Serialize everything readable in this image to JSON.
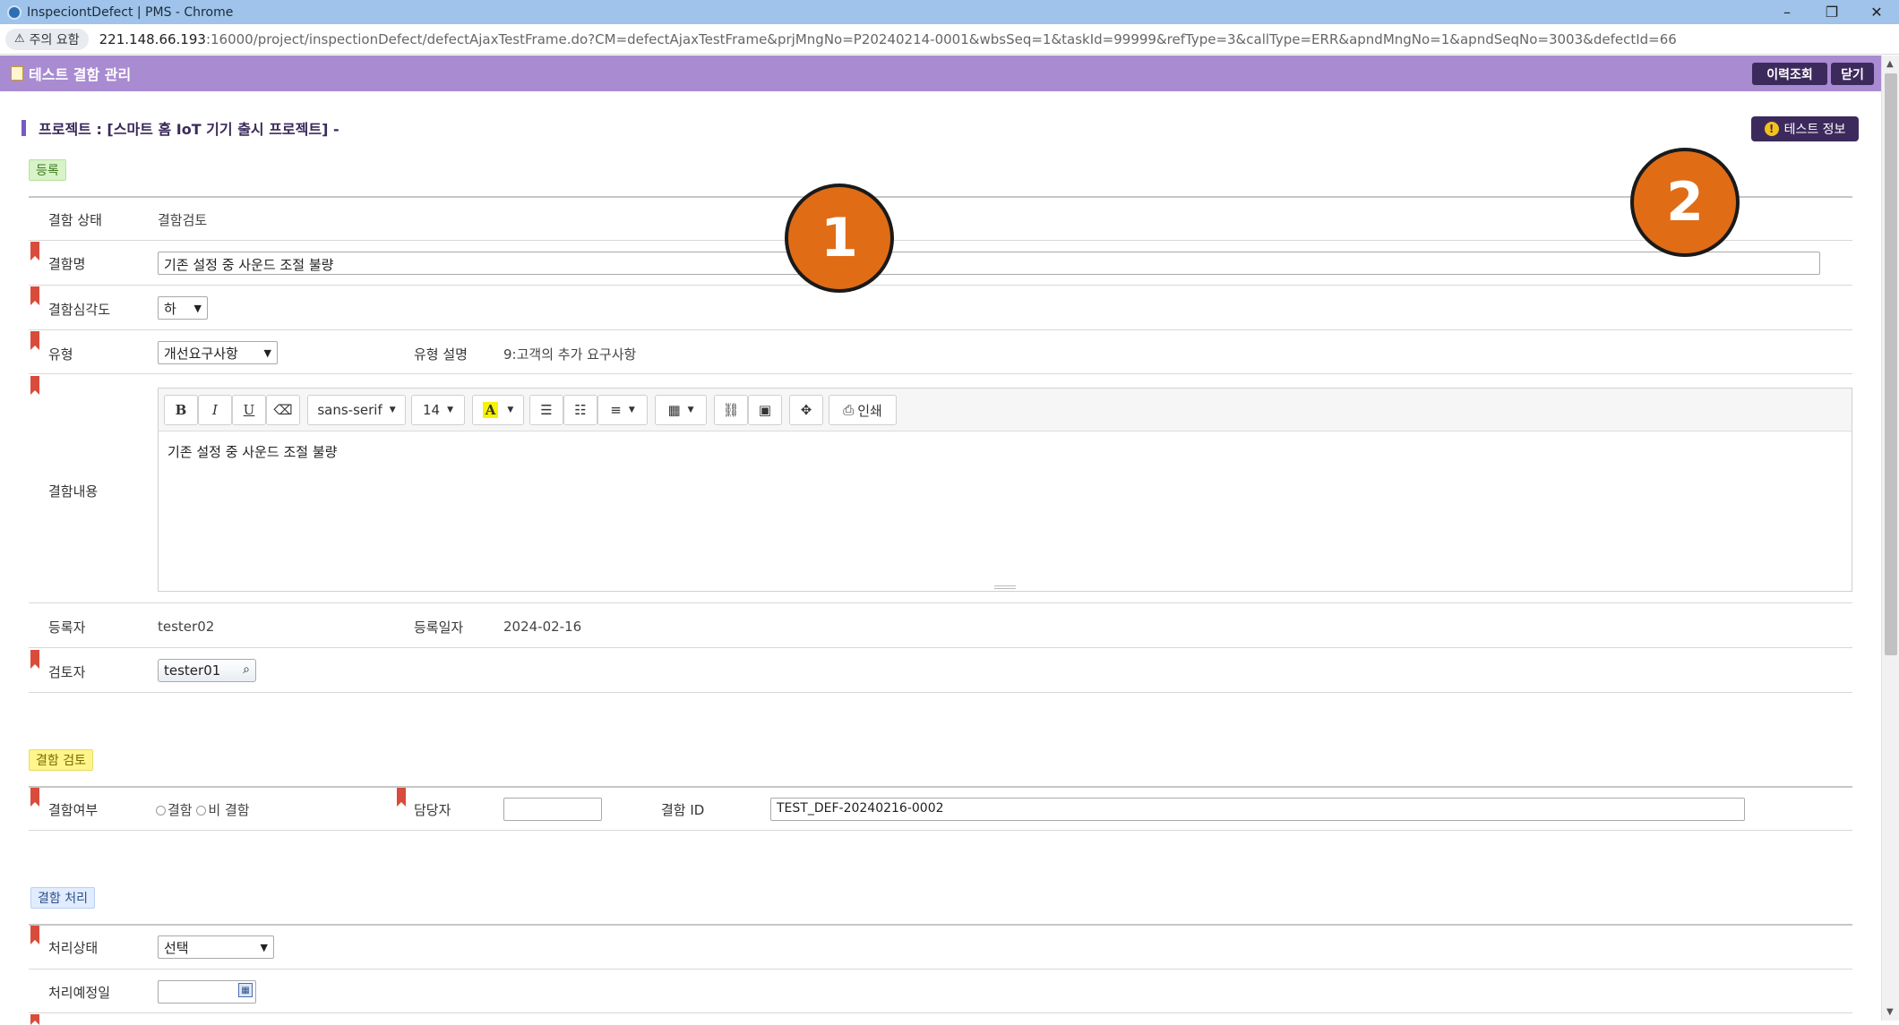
{
  "window": {
    "title": "InspeciontDefect | PMS - Chrome",
    "controls": {
      "minimize": "–",
      "restore": "❐",
      "close": "✕"
    }
  },
  "addressbar": {
    "security_label": "주의 요함",
    "url_host": "221.148.66.193",
    "url_rest": ":16000/project/inspectionDefect/defectAjaxTestFrame.do?CM=defectAjaxTestFrame&prjMngNo=P20240214-0001&wbsSeq=1&taskId=99999&refType=3&callType=ERR&apndMngNo=1&apndSeqNo=3003&defectId=66"
  },
  "header": {
    "title": "테스트 결함 관리",
    "history_button": "이력조회",
    "close_button": "닫기"
  },
  "project": {
    "line": "프로젝트 : [스마트 홈 IoT 기기 출시 프로젝트] -",
    "test_info_button": "테스트 정보"
  },
  "sections": {
    "register": "등록",
    "review": "결함 검토",
    "process": "결함 처리"
  },
  "form": {
    "status_label": "결함 상태",
    "status_value": "결함검토",
    "name_label": "결함명",
    "name_value": "기존 설정 중 사운드 조절 불량",
    "severity_label": "결함심각도",
    "severity_value": "하",
    "type_label": "유형",
    "type_value": "개선요구사항",
    "type_desc_label": "유형 설명",
    "type_desc_value": "9:고객의 추가 요구사항",
    "content_label": "결함내용",
    "content_value": "기존 설정 중 사운드 조절 불량",
    "registrant_label": "등록자",
    "registrant_value": "tester02",
    "reg_date_label": "등록일자",
    "reg_date_value": "2024-02-16",
    "reviewer_label": "검토자",
    "reviewer_value": "tester01",
    "defect_yn_label": "결함여부",
    "defect_yes": "결함",
    "defect_no": "비 결함",
    "assignee_label": "담당자",
    "assignee_value": "",
    "defect_id_label": "결함 ID",
    "defect_id_value": "TEST_DEF-20240216-0002",
    "proc_status_label": "처리상태",
    "proc_status_value": "선택",
    "proc_date_label": "처리예정일",
    "proc_date_value": ""
  },
  "editor": {
    "bold": "B",
    "italic": "I",
    "underline": "U",
    "eraser": "⌫",
    "font_family": "sans-serif",
    "font_size": "14",
    "color": "A",
    "print": "인쇄"
  },
  "annotations": [
    "1",
    "2"
  ],
  "colors": {
    "header": "#a98bd2",
    "dark_button": "#3d2a5c",
    "annotation": "#e06c16",
    "required_marker": "#d94b3b"
  }
}
